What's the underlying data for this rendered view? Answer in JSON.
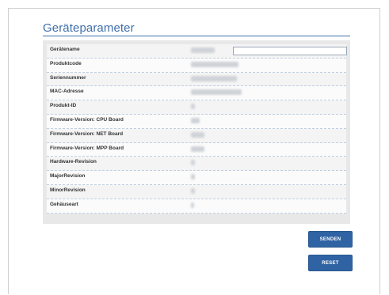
{
  "page": {
    "title": "Geräteparameter"
  },
  "device_name_input": {
    "value": ""
  },
  "rows": [
    {
      "label": "Gerätename",
      "value_hint": "redacted"
    },
    {
      "label": "Produktcode",
      "value_hint": "redacted"
    },
    {
      "label": "Seriennummer",
      "value_hint": "redacted"
    },
    {
      "label": "MAC-Adresse",
      "value_hint": "redacted"
    },
    {
      "label": "Produkt-ID",
      "value_hint": "redacted"
    },
    {
      "label": "Firmware-Version: CPU Board",
      "value_hint": "redacted"
    },
    {
      "label": "Firmware-Version: NET Board",
      "value_hint": "redacted"
    },
    {
      "label": "Firmware-Version: MPP Board",
      "value_hint": "redacted"
    },
    {
      "label": "Hardware-Revision",
      "value_hint": "redacted"
    },
    {
      "label": "MajorRevision",
      "value_hint": "redacted"
    },
    {
      "label": "MinorRevision",
      "value_hint": "redacted"
    },
    {
      "label": "Gehäuseart",
      "value_hint": "redacted"
    }
  ],
  "buttons": {
    "send_label": "SENDEN",
    "reset_label": "RESET"
  },
  "colors": {
    "accent": "#3f6fa9",
    "button_bg": "#2f63a3",
    "panel_bg": "#e8e8e8"
  }
}
